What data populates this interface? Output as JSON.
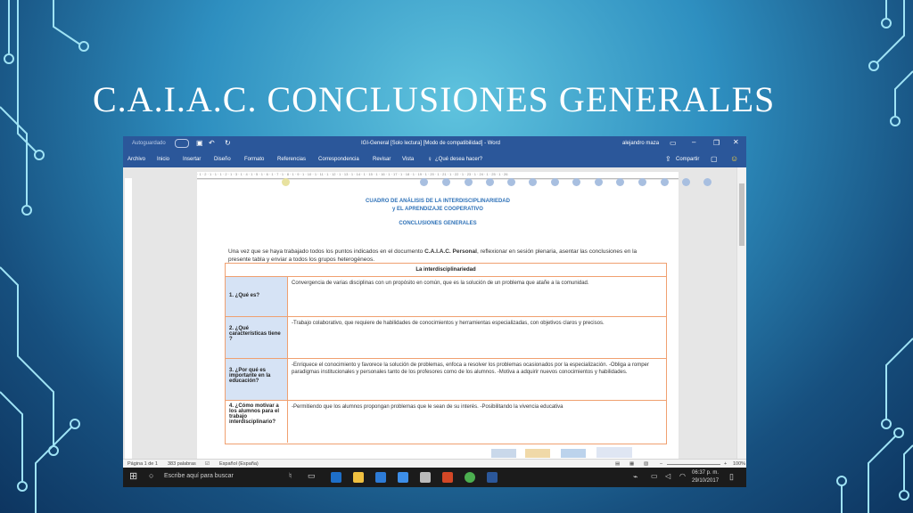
{
  "slide": {
    "title": "C.A.I.A.C. CONCLUSIONES GENERALES"
  },
  "word": {
    "title_bar": {
      "autosave_label": "Autoguardado",
      "document_title": "IGI-General [Solo lectura] [Modo de compatibilidad] - Word",
      "user": "alejandro maza"
    },
    "ribbon": {
      "tabs": [
        "Archivo",
        "Inicio",
        "Insertar",
        "Diseño",
        "Formato",
        "Referencias",
        "Correspondencia",
        "Revisar",
        "Vista"
      ],
      "tell_me": "¿Qué desea hacer?",
      "share": "Compartir"
    },
    "ruler_text": "· 1 · 2 · 1 · 1 · 1 · 2 · 1 · 3 · 1 · 4 · 1 · 5 · 1 · 6 · 1 · 7 · 1 · 8 · 1 · 9 · 1 · 10 · 1 · 11 · 1 · 12 · 1 · 13 · 1 · 14 · 1 · 15 · 1 · 16 · 1 · 17 · 1 · 18 · 1 · 19 · 1 · 20 · 1 · 21 · 1 · 22 · 1 · 23 · 1 · 24 · 1 · 25 · 1 · 26",
    "document": {
      "heading_line1": "CUADRO DE ANÁLISIS DE LA INTERDISCIPLINARIEDAD",
      "heading_line2": "y EL APRENDIZAJE COOPERATIVO",
      "heading_line3": "CONCLUSIONES GENERALES",
      "intro_part1": "Una vez que se haya trabajado todos los puntos indicados en el documento ",
      "intro_bold": "C.A.I.A.C. Personal",
      "intro_part2": ", reflexionar en sesión plenaria, asentar las conclusiones en la presente tabla y enviar a todos los grupos heterogéneos.",
      "table_header": "La interdisciplinariedad",
      "rows": [
        {
          "question": "1. ¿Qué es?",
          "answer": "Convergencia de varias disciplinas con un propósito en común, que es la solución de un problema que atañe a la comunidad."
        },
        {
          "question": "2. ¿Qué características tiene ?",
          "answer": "-Trabajo colaborativo, que requiere de habilidades de conocimientos y herramientas especializadas, con objetivos claros y precisos."
        },
        {
          "question": "3. ¿Por qué es importante en la educación?",
          "answer": "-Enriquece el conocimiento y favorece la solución de problemas, enfoca a resolver los problemas ocasionados por la especialización. -Obliga a romper paradigmas institucionales y personales tanto de los profesores como de los alumnos. -Motiva a adquirir nuevos conocimientos y habilidades."
        },
        {
          "question": "4. ¿Cómo motivar a los alumnos para el trabajo interdisciplinario?",
          "answer": "-Permitiendo que los alumnos propongan problemas que le sean de su interés. -Posibilitando la vivencia educativa"
        }
      ]
    },
    "status_bar": {
      "page": "Página 1 de 1",
      "words": "383 palabras",
      "language": "Español (España)",
      "zoom": "100%"
    }
  },
  "taskbar": {
    "search_placeholder": "Escribe aquí para buscar",
    "time": "06:37 p. m.",
    "date": "29/10/2017"
  },
  "colors": {
    "word_blue": "#2b579a",
    "table_border": "#f0a070",
    "question_cell": "#d6e3f5",
    "heading_blue": "#2f72b8"
  }
}
